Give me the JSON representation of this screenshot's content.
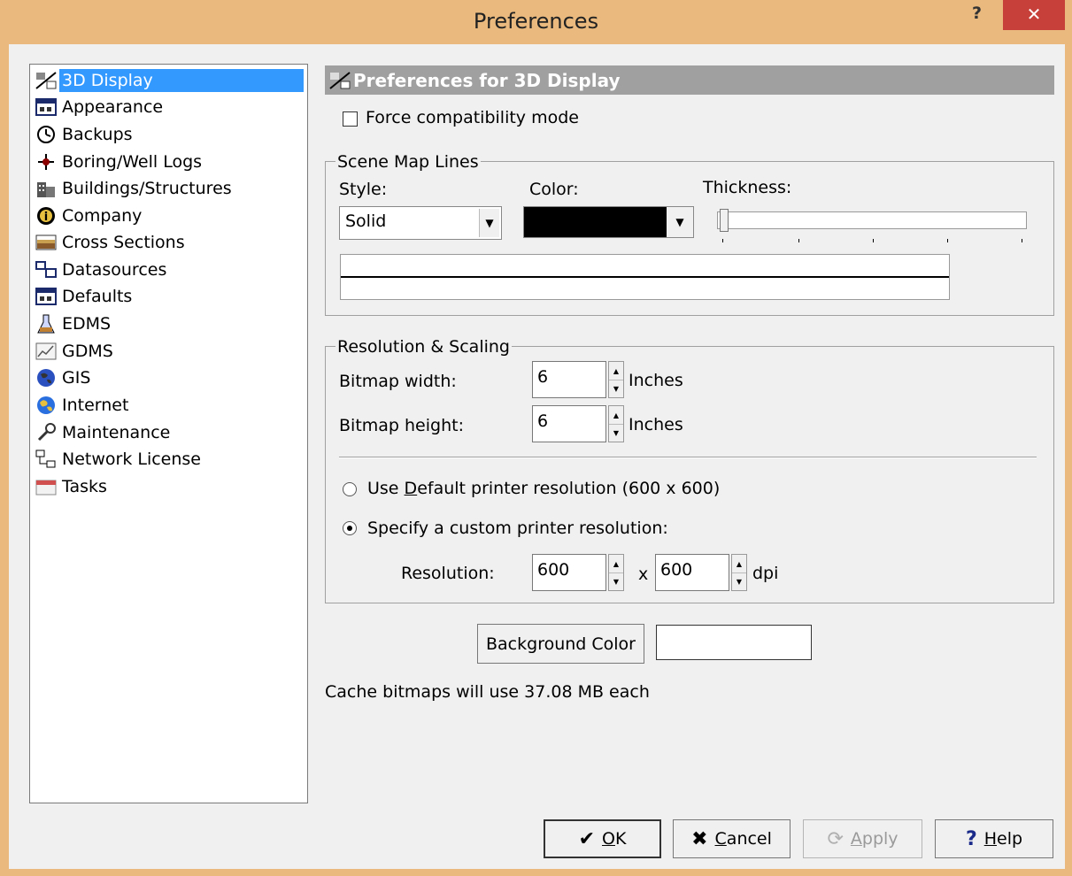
{
  "window": {
    "title": "Preferences",
    "help_glyph": "?",
    "close_glyph": "✕"
  },
  "nav": {
    "items": [
      {
        "label": "3D Display",
        "icon": "3d-display-icon",
        "selected": true
      },
      {
        "label": "Appearance",
        "icon": "appearance-icon"
      },
      {
        "label": "Backups",
        "icon": "backups-icon"
      },
      {
        "label": "Boring/Well Logs",
        "icon": "boring-logs-icon"
      },
      {
        "label": "Buildings/Structures",
        "icon": "buildings-icon"
      },
      {
        "label": "Company",
        "icon": "company-icon"
      },
      {
        "label": "Cross Sections",
        "icon": "cross-sections-icon"
      },
      {
        "label": "Datasources",
        "icon": "datasources-icon"
      },
      {
        "label": "Defaults",
        "icon": "defaults-icon"
      },
      {
        "label": "EDMS",
        "icon": "edms-icon"
      },
      {
        "label": "GDMS",
        "icon": "gdms-icon"
      },
      {
        "label": "GIS",
        "icon": "gis-icon"
      },
      {
        "label": "Internet",
        "icon": "internet-icon"
      },
      {
        "label": "Maintenance",
        "icon": "maintenance-icon"
      },
      {
        "label": "Network License",
        "icon": "network-license-icon"
      },
      {
        "label": "Tasks",
        "icon": "tasks-icon"
      }
    ]
  },
  "panel": {
    "header": "Preferences for 3D Display",
    "force_compat_label": "Force compatibility mode",
    "force_compat_checked": false,
    "scene_map_lines": {
      "legend": "Scene Map Lines",
      "style_label": "Style:",
      "style_value": "Solid",
      "color_label": "Color:",
      "color_value": "#000000",
      "thickness_label": "Thickness:",
      "thickness_level": 0
    },
    "resolution": {
      "legend": "Resolution & Scaling",
      "bitmap_width_label": "Bitmap width:",
      "bitmap_width_value": "6",
      "bitmap_height_label": "Bitmap height:",
      "bitmap_height_value": "6",
      "units": "Inches",
      "default_radio_prefix": "Use ",
      "default_radio_accel": "D",
      "default_radio_suffix": "efault printer resolution (600 x 600)",
      "custom_radio_label": "Specify a custom printer resolution:",
      "custom_selected": true,
      "resolution_label": "Resolution:",
      "res_x": "600",
      "times": "x",
      "res_y": "600",
      "dpi": "dpi"
    },
    "background_color_button": "Background Color",
    "background_color_value": "#ffffff",
    "cache_text": "Cache bitmaps will use 37.08 MB each"
  },
  "buttons": {
    "ok_accel": "O",
    "ok_rest": "K",
    "cancel_accel": "C",
    "cancel_rest": "ancel",
    "apply_accel": "A",
    "apply_rest": "pply",
    "help_accel": "H",
    "help_rest": "elp"
  }
}
